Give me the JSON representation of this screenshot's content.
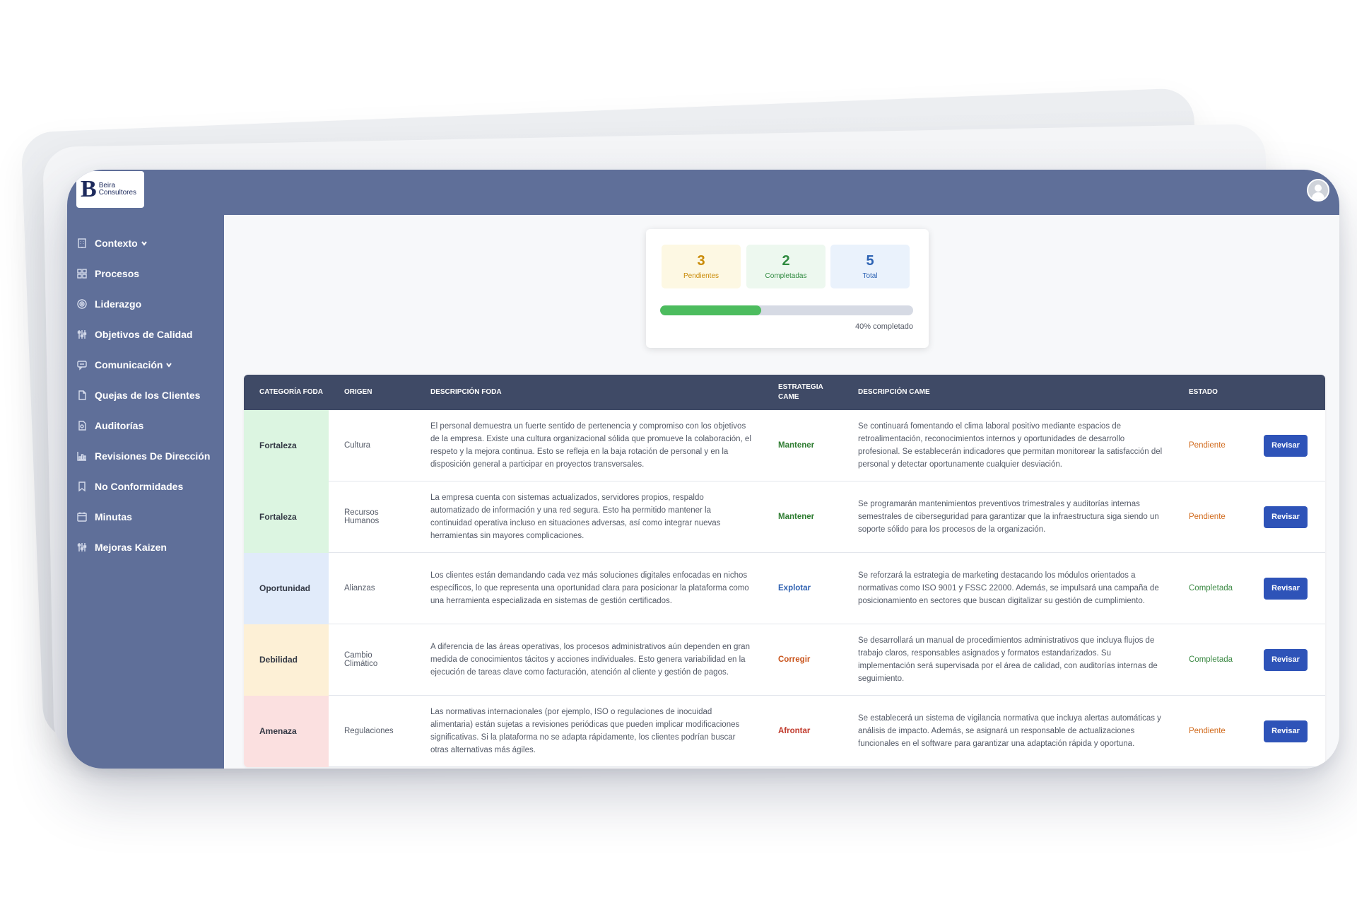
{
  "app": {
    "logo_mark": "B",
    "logo_line1": "Beira",
    "logo_line2": "Consultores"
  },
  "sidebar": {
    "items": [
      {
        "label": "Contexto",
        "icon": "building-icon",
        "has_chevron": true
      },
      {
        "label": "Procesos",
        "icon": "grid-icon",
        "has_chevron": false
      },
      {
        "label": "Liderazgo",
        "icon": "target-icon",
        "has_chevron": false
      },
      {
        "label": "Objetivos de Calidad",
        "icon": "sliders-icon",
        "has_chevron": false
      },
      {
        "label": "Comunicación",
        "icon": "chat-icon",
        "has_chevron": true
      },
      {
        "label": "Quejas de los Clientes",
        "icon": "document-icon",
        "has_chevron": false
      },
      {
        "label": "Auditorías",
        "icon": "audit-icon",
        "has_chevron": false
      },
      {
        "label": "Revisiones De Dirección",
        "icon": "chart-icon",
        "has_chevron": false
      },
      {
        "label": "No Conformidades",
        "icon": "bookmark-icon",
        "has_chevron": false
      },
      {
        "label": "Minutas",
        "icon": "calendar-icon",
        "has_chevron": false
      },
      {
        "label": "Mejoras Kaizen",
        "icon": "sliders-icon",
        "has_chevron": false
      }
    ]
  },
  "stats": {
    "pending_value": "3",
    "pending_label": "Pendientes",
    "completed_value": "2",
    "completed_label": "Completadas",
    "total_value": "5",
    "total_label": "Total",
    "progress_fraction": 0.4,
    "progress_label": "40% completado"
  },
  "table": {
    "headers": {
      "categoria": "CATEGORÍA FODA",
      "origen": "ORIGEN",
      "descripcion_foda": "DESCRIPCIÓN FODA",
      "estrategia": "ESTRATEGIA CAME",
      "descripcion_came": "DESCRIPCIÓN CAME",
      "estado": "ESTADO"
    },
    "rows": [
      {
        "categoria": "Fortaleza",
        "cat_color": "#dcf5e1",
        "origen": "Cultura",
        "descripcion_foda": "El personal demuestra un fuerte sentido de pertenencia y compromiso con los objetivos de la empresa. Existe una cultura organizacional sólida que promueve la colaboración, el respeto y la mejora continua. Esto se refleja en la baja rotación de personal y en la disposición general a participar en proyectos transversales.",
        "estrategia": "Mantener",
        "estrategia_color": "#2f7d32",
        "descripcion_came": "Se continuará fomentando el clima laboral positivo mediante espacios de retroalimentación, reconocimientos internos y oportunidades de desarrollo profesional. Se establecerán indicadores que permitan monitorear la satisfacción del personal y detectar oportunamente cualquier desviación.",
        "estado": "Pendiente",
        "estado_color": "#d16a1c",
        "accion": "Revisar"
      },
      {
        "categoria": "Fortaleza",
        "cat_color": "#dcf5e1",
        "origen": "Recursos Humanos",
        "descripcion_foda": "La empresa cuenta con sistemas actualizados, servidores propios, respaldo automatizado de información y una red segura. Esto ha permitido mantener la continuidad operativa incluso en situaciones adversas, así como integrar nuevas herramientas sin mayores complicaciones.",
        "estrategia": "Mantener",
        "estrategia_color": "#2f7d32",
        "descripcion_came": "Se programarán mantenimientos preventivos trimestrales y auditorías internas semestrales de ciberseguridad para garantizar que la infraestructura siga siendo un soporte sólido para los procesos de la organización.",
        "estado": "Pendiente",
        "estado_color": "#d16a1c",
        "accion": "Revisar"
      },
      {
        "categoria": "Oportunidad",
        "cat_color": "#e1ebfa",
        "origen": "Alianzas",
        "descripcion_foda": "Los clientes están demandando cada vez más soluciones digitales enfocadas en nichos específicos, lo que representa una oportunidad clara para posicionar la plataforma como una herramienta especializada en sistemas de gestión certificados.",
        "estrategia": "Explotar",
        "estrategia_color": "#2c5fb0",
        "descripcion_came": "Se reforzará la estrategia de marketing destacando los módulos orientados a normativas como ISO 9001 y FSSC 22000. Además, se impulsará una campaña de posicionamiento en sectores que buscan digitalizar su gestión de cumplimiento.",
        "estado": "Completada",
        "estado_color": "#3d8a45",
        "accion": "Revisar"
      },
      {
        "categoria": "Debilidad",
        "cat_color": "#fdf0d6",
        "origen": "Cambio Climático",
        "descripcion_foda": "A diferencia de las áreas operativas, los procesos administrativos aún dependen en gran medida de conocimientos tácitos y acciones individuales. Esto genera variabilidad en la ejecución de tareas clave como facturación, atención al cliente y gestión de pagos.",
        "estrategia": "Corregir",
        "estrategia_color": "#c9541c",
        "descripcion_came": "Se desarrollará un manual de procedimientos administrativos que incluya flujos de trabajo claros, responsables asignados y formatos estandarizados. Su implementación será supervisada por el área de calidad, con auditorías internas de seguimiento.",
        "estado": "Completada",
        "estado_color": "#3d8a45",
        "accion": "Revisar"
      },
      {
        "categoria": "Amenaza",
        "cat_color": "#fbe0e0",
        "origen": "Regulaciones",
        "descripcion_foda": "Las normativas internacionales (por ejemplo, ISO o regulaciones de inocuidad alimentaria) están sujetas a revisiones periódicas que pueden implicar modificaciones significativas. Si la plataforma no se adapta rápidamente, los clientes podrían buscar otras alternativas más ágiles.",
        "estrategia": "Afrontar",
        "estrategia_color": "#c0392b",
        "descripcion_came": "Se establecerá un sistema de vigilancia normativa que incluya alertas automáticas y análisis de impacto. Además, se asignará un responsable de actualizaciones funcionales en el software para garantizar una adaptación rápida y oportuna.",
        "estado": "Pendiente",
        "estado_color": "#d16a1c",
        "accion": "Revisar"
      }
    ]
  }
}
